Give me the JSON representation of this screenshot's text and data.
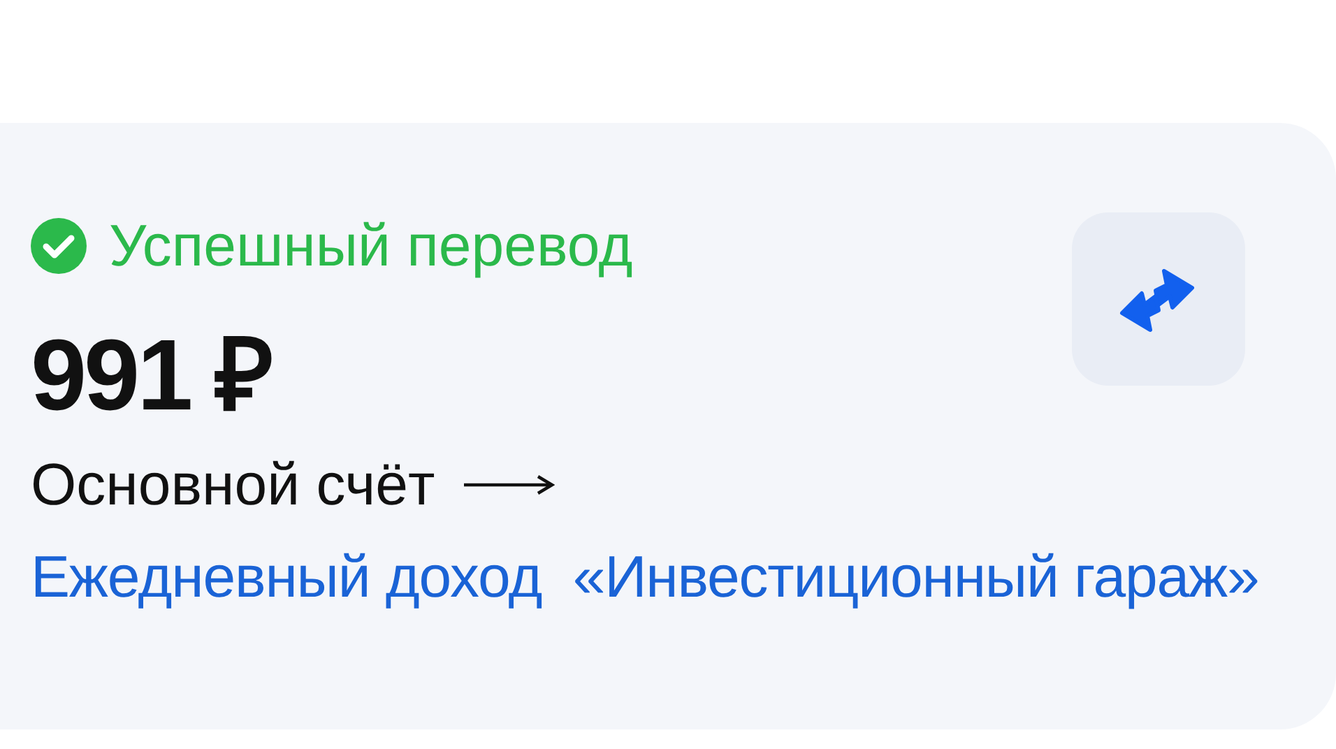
{
  "operation": {
    "status": {
      "text": "Успешный перевод",
      "kind": "success"
    },
    "amount": "991 ₽",
    "account": "Основной счёт",
    "description": "Ежедневный доход  «Инвестиционный гараж»"
  }
}
